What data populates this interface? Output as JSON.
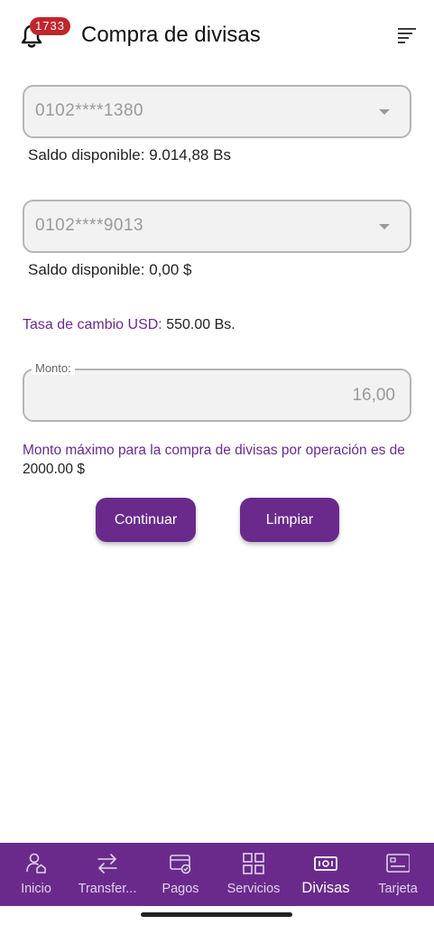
{
  "header": {
    "notification_count": "1733",
    "title": "Compra de divisas"
  },
  "origin_account": {
    "value": "0102****1380",
    "balance": "Saldo disponible: 9.014,88 Bs"
  },
  "destination_account": {
    "value": "0102****9013",
    "balance": "Saldo disponible: 0,00 $"
  },
  "rate": {
    "label": "Tasa de cambio USD:",
    "value": "550.00 Bs."
  },
  "amount": {
    "label": "Monto:",
    "value": "16,00"
  },
  "limit_note": {
    "text": "Monto máximo para la compra de divisas por operación  es de",
    "value": "2000.00 $"
  },
  "buttons": {
    "continue": "Continuar",
    "clear": "Limpiar"
  },
  "nav": {
    "items": [
      {
        "label": "Inicio",
        "icon": "home-user-icon"
      },
      {
        "label": "Transfer...",
        "icon": "transfer-arrows-icon"
      },
      {
        "label": "Pagos",
        "icon": "payment-card-icon"
      },
      {
        "label": "Servicios",
        "icon": "grid-icon"
      },
      {
        "label": "Divisas",
        "icon": "banknote-icon",
        "active": true
      },
      {
        "label": "Tarjeta",
        "icon": "card-icon"
      }
    ]
  },
  "colors": {
    "brand": "#6a2a8c",
    "badge": "#c0262c",
    "field_bg": "#f2f2f2"
  }
}
